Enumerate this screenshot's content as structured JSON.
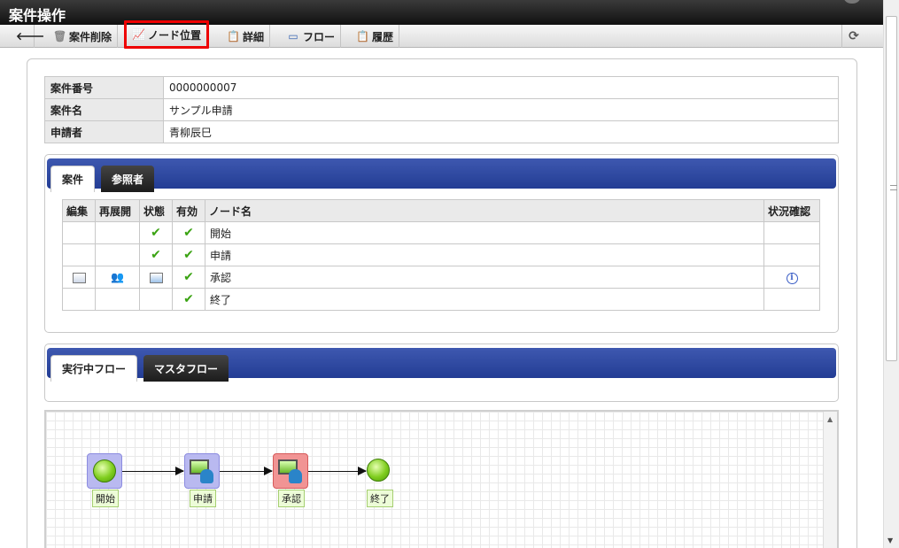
{
  "window": {
    "title": "案件操作"
  },
  "toolbar": {
    "back_icon": "left-arrow-icon",
    "delete_label": "案件削除",
    "node_position_label": "ノード位置",
    "detail_label": "詳細",
    "flow_label": "フロー",
    "history_label": "履歴",
    "refresh_icon": "refresh-icon"
  },
  "info": {
    "rows": [
      {
        "key": "案件番号",
        "value": "0000000007"
      },
      {
        "key": "案件名",
        "value": "サンプル申請"
      },
      {
        "key": "申請者",
        "value": "青柳辰巳"
      }
    ]
  },
  "case_tabs": {
    "tab1": "案件",
    "tab2": "参照者"
  },
  "node_table": {
    "headers": [
      "編集",
      "再展開",
      "状態",
      "有効",
      "ノード名",
      "状況確認"
    ],
    "rows": [
      {
        "edit": false,
        "reexpand": false,
        "state": "check",
        "valid": "check",
        "name": "開始",
        "status": false
      },
      {
        "edit": false,
        "reexpand": false,
        "state": "check",
        "valid": "check",
        "name": "申請",
        "status": false
      },
      {
        "edit": true,
        "reexpand": true,
        "state": "process-icon",
        "valid": "check",
        "name": "承認",
        "status": true
      },
      {
        "edit": false,
        "reexpand": false,
        "state": "",
        "valid": "check",
        "name": "終了",
        "status": false
      }
    ],
    "check_glyph": "✔",
    "info_glyph": "i"
  },
  "flow_tabs": {
    "tab1": "実行中フロー",
    "tab2": "マスタフロー"
  },
  "flow": {
    "nodes": [
      {
        "label": "開始",
        "type": "start",
        "state": "done"
      },
      {
        "label": "申請",
        "type": "user",
        "state": "done"
      },
      {
        "label": "承認",
        "type": "user",
        "state": "current"
      },
      {
        "label": "終了",
        "type": "end",
        "state": "pending"
      }
    ]
  },
  "colors": {
    "accent_tab": "#233d94",
    "highlight": "#ee0000",
    "check": "#3aa312",
    "current_node": "#f19494",
    "done_node": "#b9b9f0"
  }
}
